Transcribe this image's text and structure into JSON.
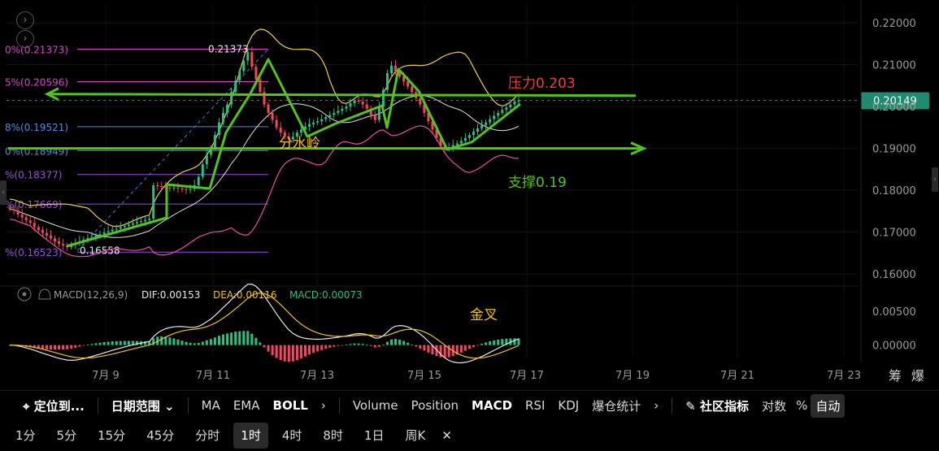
{
  "chart_data": {
    "type": "candlestick",
    "price_axis_ticks": [
      "0.22000",
      "0.21000",
      "0.20000",
      "0.19000",
      "0.18000",
      "0.17000",
      "0.16000"
    ],
    "price_range": [
      0.1575,
      0.2245
    ],
    "current_price": "0.20149",
    "x_ticks": [
      "7月 9",
      "7月 11",
      "7月 13",
      "7月 15",
      "7月 17",
      "7月 19",
      "7月 21",
      "7月 23"
    ],
    "fib_levels": [
      {
        "label": "0%(0.21373)",
        "value": 0.21373,
        "color": "#d946c8"
      },
      {
        "label": "5%(0.20596)",
        "value": 0.20596,
        "color": "#d946c8"
      },
      {
        "label": "8%(0.19521)",
        "value": 0.19521,
        "color": "#4a8fe8"
      },
      {
        "label": "0%(0.18949)",
        "value": 0.18949,
        "color": "#4a8fe8"
      },
      {
        "label": "%(0.18377)",
        "value": 0.18377,
        "color": "#9b4de0"
      },
      {
        "label": "%(0.17669)",
        "value": 0.17669,
        "color": "#9b4de0"
      },
      {
        "label": "%(0.16523)",
        "value": 0.16523,
        "color": "#9b4de0"
      }
    ],
    "high_marker": "0.21373",
    "low_marker": "0.16558",
    "annotations": {
      "resistance": "压力0.203",
      "support": "支撑0.19",
      "watershed": "分水岭",
      "golden_cross": "金叉"
    },
    "resistance_value": 0.203,
    "support_value": 0.19,
    "close_series": [
      0.1755,
      0.1752,
      0.1742,
      0.1735,
      0.1728,
      0.1722,
      0.1712,
      0.1705,
      0.1698,
      0.1692,
      0.1685,
      0.1678,
      0.1672,
      0.1668,
      0.1664,
      0.1669,
      0.1674,
      0.1678,
      0.1682,
      0.1686,
      0.1688,
      0.1692,
      0.1695,
      0.1699,
      0.1702,
      0.1706,
      0.1708,
      0.1712,
      0.1715,
      0.1718,
      0.1721,
      0.1724,
      0.1726,
      0.1729,
      0.1732,
      0.1812,
      0.181,
      0.1808,
      0.1806,
      0.1805,
      0.1806,
      0.1804,
      0.1803,
      0.1802,
      0.1803,
      0.1812,
      0.1832,
      0.1862,
      0.1885,
      0.1902,
      0.1932,
      0.1962,
      0.1985,
      0.2005,
      0.2035,
      0.2062,
      0.2085,
      0.211,
      0.213,
      0.2095,
      0.2065,
      0.2035,
      0.2005,
      0.1985,
      0.1968,
      0.195,
      0.1938,
      0.1928,
      0.1922,
      0.1928,
      0.1938,
      0.1945,
      0.1952,
      0.1958,
      0.1962,
      0.1965,
      0.197,
      0.1975,
      0.198,
      0.1985,
      0.199,
      0.1995,
      0.2,
      0.2008,
      0.2015,
      0.2012,
      0.2005,
      0.1995,
      0.198,
      0.1968,
      0.2,
      0.204,
      0.208,
      0.2098,
      0.2085,
      0.2072,
      0.206,
      0.2048,
      0.2035,
      0.202,
      0.2005,
      0.1985,
      0.1965,
      0.1945,
      0.1925,
      0.1905,
      0.19,
      0.1903,
      0.1908,
      0.1912,
      0.1918,
      0.1925,
      0.1932,
      0.194,
      0.1948,
      0.1955,
      0.1962,
      0.197,
      0.1978,
      0.1985,
      0.1992,
      0.1998,
      0.2005,
      0.2012,
      0.2015
    ],
    "macd": {
      "label": "MACD(12,26,9)",
      "dif": "DIF:0.00153",
      "dea": "DEA:0.00116",
      "macd": "MACD:0.00073",
      "ticks": [
        "0.00500",
        "0.00000"
      ],
      "range": [
        -0.0016,
        0.0063
      ]
    }
  },
  "toolbar": {
    "locate": "定位到...",
    "date_range": "日期范围",
    "indicators_main": [
      "MA",
      "EMA",
      "BOLL"
    ],
    "indicators_sub": [
      "Volume",
      "Position",
      "MACD",
      "RSI",
      "KDJ",
      "爆仓统计"
    ],
    "community": "社区指标",
    "log": "对数",
    "percent": "%",
    "auto": "自动"
  },
  "intervals": [
    "1分",
    "5分",
    "15分",
    "45分",
    "分时",
    "1时",
    "4时",
    "8时",
    "1日",
    "周K"
  ],
  "active_interval": "1时",
  "axis_corner": [
    "筹",
    "爆"
  ],
  "colors": {
    "up": "#2ebd85",
    "down": "#f6465d",
    "trend": "#52c41a",
    "boll_mid": "#e0e0e0",
    "boll_upper": "#f0d04a",
    "boll_lower": "#e84fa8",
    "resistance_text": "#f03c3c",
    "support_text": "#52c41a",
    "watershed_text": "#f0c020"
  }
}
